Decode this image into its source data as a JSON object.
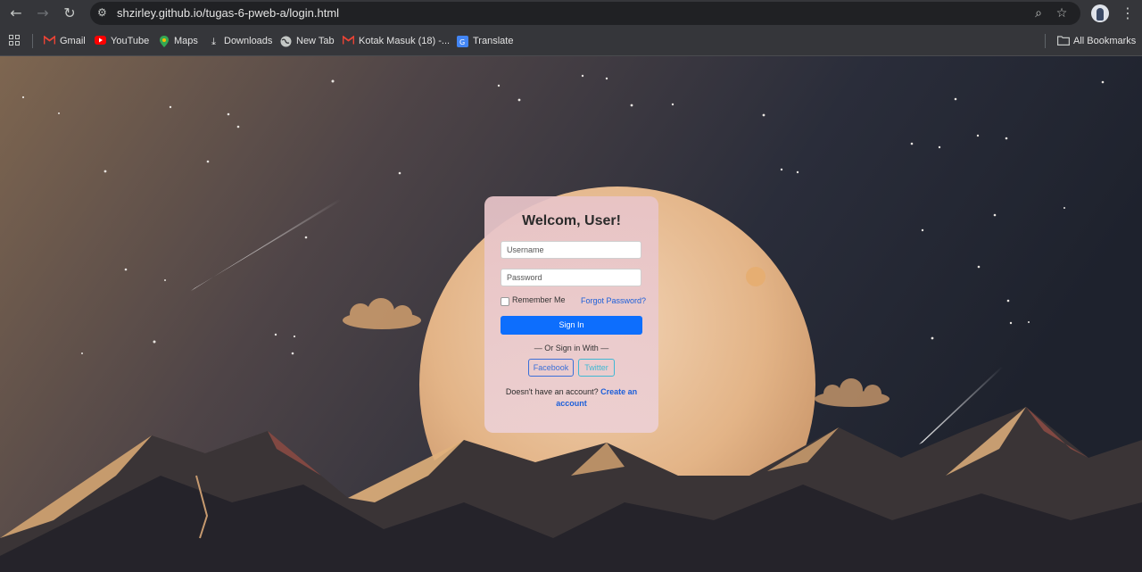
{
  "browser": {
    "url": "shzirley.github.io/tugas-6-pweb-a/login.html",
    "bookmarks": [
      {
        "label": "Gmail",
        "icon": "gmail-icon"
      },
      {
        "label": "YouTube",
        "icon": "youtube-icon"
      },
      {
        "label": "Maps",
        "icon": "maps-icon"
      },
      {
        "label": "Downloads",
        "icon": "download-icon"
      },
      {
        "label": "New Tab",
        "icon": "globe-icon"
      },
      {
        "label": "Kotak Masuk (18) -...",
        "icon": "gmail-icon"
      },
      {
        "label": "Translate",
        "icon": "translate-icon"
      }
    ],
    "all_bookmarks": "All Bookmarks"
  },
  "login": {
    "title": "Welcom, User!",
    "username_placeholder": "Username",
    "password_placeholder": "Password",
    "remember_label": "Remember Me",
    "forgot_label": "Forgot Password?",
    "signin_label": "Sign In",
    "or_label": "— Or Sign in With —",
    "facebook_label": "Facebook",
    "twitter_label": "Twitter",
    "no_account_text": "Doesn't have an account?",
    "create_account_label": "Create an account",
    "primary_color": "#0d6efd"
  }
}
